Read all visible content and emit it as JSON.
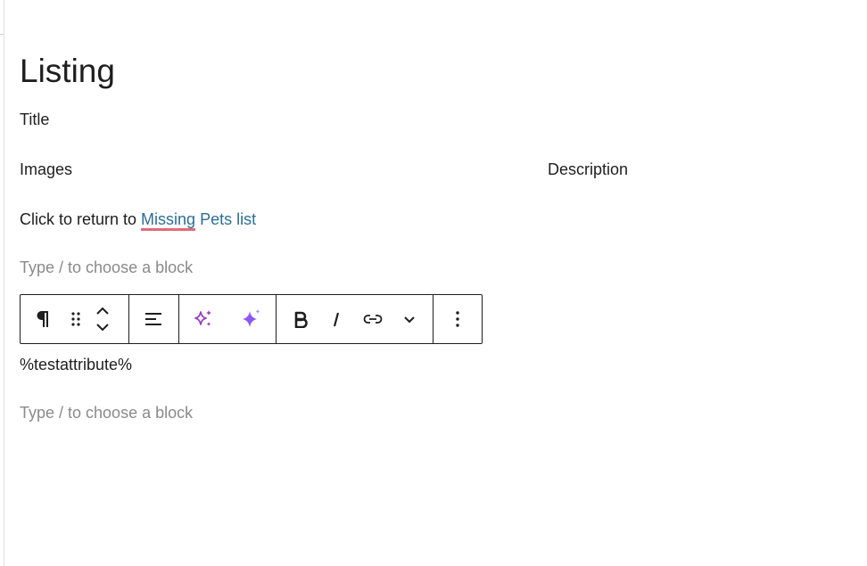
{
  "page": {
    "title": "Listing"
  },
  "fields": {
    "title_label": "Title",
    "images_label": "Images",
    "description_label": "Description"
  },
  "return_line": {
    "prefix": "Click to return to ",
    "link_word1": "Missing",
    "link_rest": " Pets list"
  },
  "placeholders": {
    "block_1": "Type / to choose a block",
    "block_2": "Type / to choose a block"
  },
  "attribute_block": {
    "text": "%testattribute%"
  },
  "toolbar": {
    "icons": [
      "paragraph-icon",
      "drag-handle-icon",
      "move-up-icon",
      "move-down-icon",
      "align-icon",
      "ai-sparkle-outline-icon",
      "ai-sparkle-filled-icon",
      "bold-icon",
      "italic-icon",
      "link-icon",
      "chevron-down-icon",
      "more-options-icon"
    ],
    "accent_purple": "#9b3fc6",
    "accent_violet": "#8b5cf6"
  }
}
